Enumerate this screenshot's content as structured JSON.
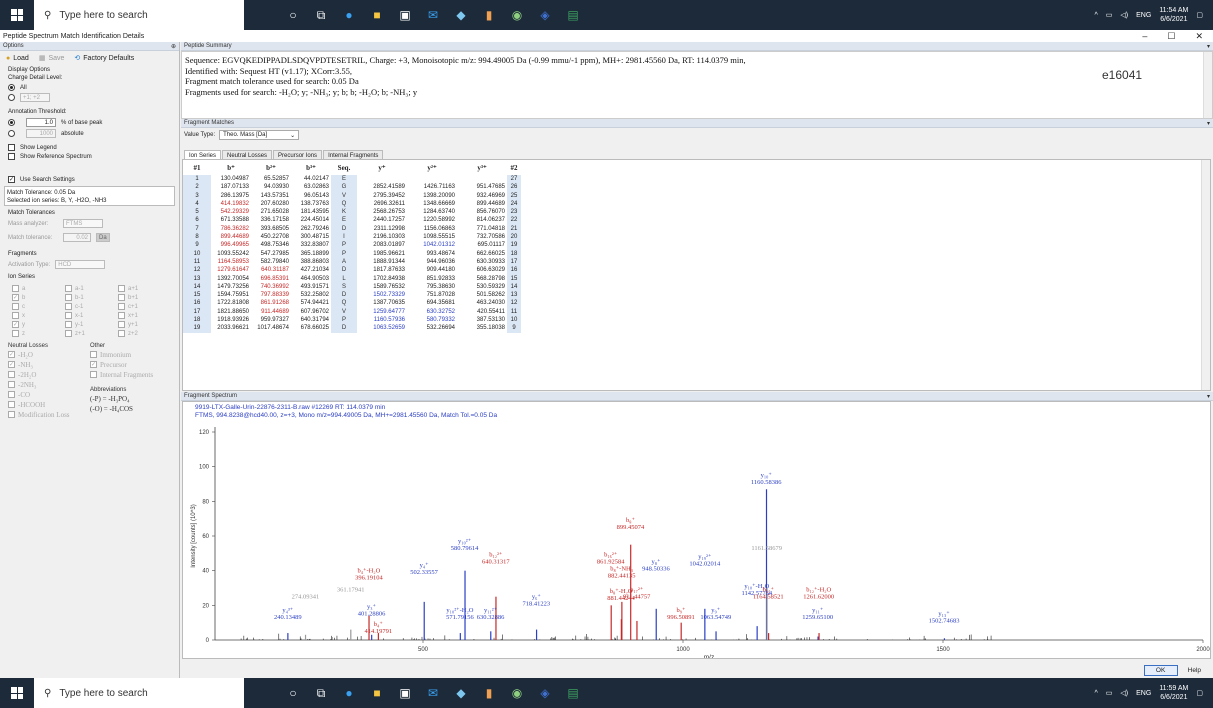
{
  "taskbar_top": {
    "search_placeholder": "Type here to search",
    "time": "11:54 AM",
    "date": "6/6/2021",
    "lang": "ENG"
  },
  "taskbar_bottom": {
    "search_placeholder": "Type here to search",
    "time": "11:59 AM",
    "date": "6/6/2021",
    "lang": "ENG"
  },
  "window": {
    "title": "Peptide Spectrum Match Identification Details",
    "min": "–",
    "max": "☐",
    "close": "✕"
  },
  "options": {
    "header": "Options",
    "load": "Load",
    "save": "Save",
    "factory": "Factory Defaults",
    "display_options": "Display Options",
    "charge_level": "Charge Detail Level:",
    "all": "All",
    "charge_value": "+1; +2",
    "annotation_threshold": "Annotation Threshold:",
    "pct_value": "1.0",
    "pct_label": "% of base peak",
    "abs_value": "1000",
    "abs_label": "absolute",
    "show_legend": "Show Legend",
    "show_reference": "Show Reference Spectrum",
    "use_search": "Use Search Settings",
    "info_line1": "Match Tolerance: 0.05 Da",
    "info_line2": "Selected ion series: B, Y, -H2O, -NH3",
    "match_tol": "Match Tolerances",
    "mass_analyzer": "Mass analyzer:",
    "mass_analyzer_val": "FTMS",
    "match_tolerance": "Match tolerance:",
    "tol_val": "0.02",
    "tol_unit": "Da",
    "fragments": "Fragments",
    "activation": "Activation Type:",
    "activation_val": "HCD",
    "ion_series": "Ion Series",
    "ions": [
      [
        "a",
        "a-1",
        "a+1"
      ],
      [
        "b",
        "b-1",
        "b+1"
      ],
      [
        "c",
        "c-1",
        "c+1"
      ],
      [
        "x",
        "x-1",
        "x+1"
      ],
      [
        "y",
        "y-1",
        "y+1"
      ],
      [
        "z",
        "z+1",
        "z+2"
      ]
    ],
    "neutral_losses": "Neutral Losses",
    "other": "Other",
    "nl": [
      "-H₂O",
      "-NH₃",
      "-2H₂O",
      "-2NH₃",
      "-CO",
      "-HCOOH",
      "Modification Loss"
    ],
    "other_items": [
      "Immonium",
      "Precursor",
      "Internal Fragments"
    ],
    "abbrev": "Abbreviations",
    "abbr1": "(-P) = -H₃PO₄",
    "abbr2": "(-O) = -H₄COS"
  },
  "summary": {
    "header": "Peptide Summary",
    "line1": "Sequence: EGVQKEDIPPADLSDQVPDTESETRIL, Charge: +3,   Monoisotopic m/z: 994.49005 Da (-0.99 mmu/-1 ppm),   MH+: 2981.45560 Da,   RT: 114.0379 min,",
    "line2": "Identified with: Sequest HT (v1.17); XCorr:3.55,",
    "line3": "Fragment match tolerance used for search: 0.05 Da",
    "line4": "Fragments used for search: -H₂O; y; -NH₃; y; b; b; -H₂O; b; -NH₃; y",
    "id": "e16041"
  },
  "fragment_matches": {
    "header": "Fragment Matches",
    "value_type_label": "Value Type:",
    "value_type": "Theo. Mass [Da]",
    "tabs": [
      "Ion Series",
      "Neutral Losses",
      "Precursor Ions",
      "Internal Fragments"
    ],
    "columns": [
      "#1",
      "b⁺",
      "b²⁺",
      "b³⁺",
      "Seq.",
      "y⁺",
      "y²⁺",
      "y³⁺",
      "#2"
    ],
    "rows": [
      [
        "1",
        "130.04987",
        "65.52857",
        "44.02147",
        "E",
        "",
        "",
        "",
        "27"
      ],
      [
        "2",
        "187.07133",
        "94.03930",
        "63.02863",
        "G",
        "2852.41589",
        "1426.71163",
        "951.47685",
        "26"
      ],
      [
        "3",
        "286.13975",
        "143.57351",
        "96.05143",
        "V",
        "2795.39452",
        "1398.20090",
        "932.46969",
        "25"
      ],
      [
        "4",
        "414.19832",
        "207.60280",
        "138.73763",
        "Q",
        "2696.32611",
        "1348.66669",
        "899.44689",
        "24"
      ],
      [
        "5",
        "542.29329",
        "271.65028",
        "181.43595",
        "K",
        "2568.26753",
        "1284.63740",
        "856.76070",
        "23"
      ],
      [
        "6",
        "671.33588",
        "336.17158",
        "224.45014",
        "E",
        "2440.17257",
        "1220.58992",
        "814.06237",
        "22"
      ],
      [
        "7",
        "786.36282",
        "393.68505",
        "262.79246",
        "D",
        "2311.12998",
        "1156.06863",
        "771.04818",
        "21"
      ],
      [
        "8",
        "899.44689",
        "450.22708",
        "300.48715",
        "I",
        "2196.10303",
        "1098.55515",
        "732.70586",
        "20"
      ],
      [
        "9",
        "996.49965",
        "498.75346",
        "332.83807",
        "P",
        "2083.01897",
        "1042.01312",
        "695.01117",
        "19"
      ],
      [
        "10",
        "1093.55242",
        "547.27985",
        "365.18899",
        "P",
        "1985.96621",
        "993.48674",
        "662.66025",
        "18"
      ],
      [
        "11",
        "1164.58953",
        "582.79840",
        "388.86803",
        "A",
        "1888.91344",
        "944.96036",
        "630.30933",
        "17"
      ],
      [
        "12",
        "1279.61647",
        "640.31187",
        "427.21034",
        "D",
        "1817.87633",
        "909.44180",
        "606.63029",
        "16"
      ],
      [
        "13",
        "1392.70054",
        "696.85391",
        "464.90503",
        "L",
        "1702.84938",
        "851.92833",
        "568.28798",
        "15"
      ],
      [
        "14",
        "1479.73256",
        "740.36992",
        "493.91571",
        "S",
        "1589.76532",
        "795.38630",
        "530.59329",
        "14"
      ],
      [
        "15",
        "1594.75951",
        "797.88339",
        "532.25802",
        "D",
        "1502.73329",
        "751.87028",
        "501.58262",
        "13"
      ],
      [
        "16",
        "1722.81808",
        "861.91268",
        "574.94421",
        "Q",
        "1387.70635",
        "694.35681",
        "463.24030",
        "12"
      ],
      [
        "17",
        "1821.88650",
        "911.44689",
        "607.96702",
        "V",
        "1259.64777",
        "630.32752",
        "420.55411",
        "11"
      ],
      [
        "18",
        "1918.93926",
        "959.97327",
        "640.31794",
        "P",
        "1160.57936",
        "580.79332",
        "387.53130",
        "10"
      ],
      [
        "19",
        "2033.96621",
        "1017.48674",
        "678.66025",
        "D",
        "1063.52659",
        "532.26694",
        "355.18038",
        "9"
      ]
    ],
    "red_cells": [
      "4-1",
      "5-1",
      "7-1",
      "8-1",
      "9-1",
      "11-1",
      "12-1",
      "12-2",
      "13-2",
      "14-2",
      "15-2",
      "16-2",
      "17-2"
    ],
    "blue_cells": [
      "9-6",
      "15-5",
      "17-5",
      "17-6",
      "18-5",
      "18-6",
      "19-5"
    ]
  },
  "spectrum": {
    "header": "Fragment Spectrum",
    "title1": "9919-LTX-Galle-Urin-22876-2311-B.raw #12269 RT: 114.0379 min",
    "title2": "FTMS, 994.8238@hcd40.00, z=+3, Mono m/z=994.49005 Da, MH+=2981.45560 Da, Match Tol.=0.05 Da",
    "ylabel": "Intensity [counts] (10^3)",
    "xlabel": "m/z",
    "yticks": [
      "0",
      "20",
      "40",
      "60",
      "80",
      "100",
      "120"
    ],
    "xticks": [
      "500",
      "1000",
      "1500",
      "2000"
    ],
    "peaks": [
      {
        "mz": 240.13489,
        "h": 4,
        "c": "#2b3fc4"
      },
      {
        "mz": 274.09,
        "h": 3,
        "c": "#999"
      },
      {
        "mz": 361.18,
        "h": 6,
        "c": "#999"
      },
      {
        "mz": 396.19104,
        "h": 14,
        "c": "#c62828"
      },
      {
        "mz": 401.28806,
        "h": 3,
        "c": "#2b3fc4"
      },
      {
        "mz": 414.19791,
        "h": 4,
        "c": "#c62828"
      },
      {
        "mz": 502.33557,
        "h": 22,
        "c": "#2b3fc4"
      },
      {
        "mz": 571.79156,
        "h": 4,
        "c": "#2b3fc4"
      },
      {
        "mz": 580.79614,
        "h": 40,
        "c": "#2b3fc4"
      },
      {
        "mz": 630.32886,
        "h": 5,
        "c": "#2b3fc4"
      },
      {
        "mz": 640.31317,
        "h": 25,
        "c": "#c62828"
      },
      {
        "mz": 718.41223,
        "h": 6,
        "c": "#2b3fc4"
      },
      {
        "mz": 861.92584,
        "h": 20,
        "c": "#c62828"
      },
      {
        "mz": 881.44244,
        "h": 12,
        "c": "#c62828"
      },
      {
        "mz": 882.44135,
        "h": 22,
        "c": "#c62828"
      },
      {
        "mz": 899.45074,
        "h": 55,
        "c": "#c62828"
      },
      {
        "mz": 911.44757,
        "h": 11,
        "c": "#c62828"
      },
      {
        "mz": 948.50336,
        "h": 18,
        "c": "#2b3fc4"
      },
      {
        "mz": 996.50891,
        "h": 10,
        "c": "#c62828"
      },
      {
        "mz": 1042.02014,
        "h": 18,
        "c": "#2b3fc4"
      },
      {
        "mz": 1063.54749,
        "h": 5,
        "c": "#2b3fc4"
      },
      {
        "mz": 1142.57764,
        "h": 8,
        "c": "#2b3fc4"
      },
      {
        "mz": 1160.58386,
        "h": 87,
        "c": "#2b3fc4"
      },
      {
        "mz": 1161.58679,
        "h": 30,
        "c": "#999"
      },
      {
        "mz": 1164.58521,
        "h": 4,
        "c": "#c62828"
      },
      {
        "mz": 1259.651,
        "h": 2,
        "c": "#2b3fc4"
      },
      {
        "mz": 1261.62,
        "h": 4,
        "c": "#c62828"
      },
      {
        "mz": 1502.74683,
        "h": 1,
        "c": "#2b3fc4"
      }
    ],
    "labels": [
      {
        "t": "240.13489",
        "sup": "y₄³⁺",
        "mz": 240,
        "y": 12,
        "c": "#2b3fc4"
      },
      {
        "t": "274.09341",
        "mz": 274,
        "y": 24,
        "c": "#999"
      },
      {
        "t": "361.17941",
        "mz": 361,
        "y": 28,
        "c": "#999"
      },
      {
        "t": "396.19104",
        "sup": "b₄⁺-H₂O",
        "mz": 396,
        "y": 35,
        "c": "#c62828"
      },
      {
        "t": "401.28806",
        "sup": "y₃⁺",
        "mz": 401,
        "y": 14,
        "c": "#2b3fc4"
      },
      {
        "t": "414.19791",
        "sup": "b₄⁺",
        "mz": 414,
        "y": 4,
        "c": "#c62828"
      },
      {
        "t": "502.33557",
        "sup": "y₄⁺",
        "mz": 502,
        "y": 38,
        "c": "#2b3fc4"
      },
      {
        "t": "571.79156",
        "sup": "y₁₀²⁺-H₂O",
        "mz": 571,
        "y": 12,
        "c": "#2b3fc4"
      },
      {
        "t": "580.79614",
        "sup": "y₁₀²⁺",
        "mz": 580,
        "y": 52,
        "c": "#2b3fc4"
      },
      {
        "t": "630.32886",
        "sup": "y₁₁²⁺",
        "mz": 630,
        "y": 12,
        "c": "#2b3fc4"
      },
      {
        "t": "640.31317",
        "sup": "b₁₂²⁺",
        "mz": 640,
        "y": 44,
        "c": "#c62828"
      },
      {
        "t": "718.41223",
        "sup": "y₆⁺",
        "mz": 718,
        "y": 20,
        "c": "#2b3fc4"
      },
      {
        "t": "861.92584",
        "sup": "b₁₆²⁺",
        "mz": 861,
        "y": 44,
        "c": "#c62828"
      },
      {
        "t": "882.44135",
        "sup": "b₈⁺-NH₃",
        "mz": 882,
        "y": 36,
        "c": "#c62828"
      },
      {
        "t": "881.44244",
        "sup": "b₈⁺-H₂O",
        "mz": 881,
        "y": 23,
        "c": "#c62828"
      },
      {
        "t": "899.45074",
        "sup": "b₈⁺",
        "mz": 899,
        "y": 64,
        "c": "#c62828"
      },
      {
        "t": "911.44757",
        "sup": "b₁₇²⁺",
        "mz": 911,
        "y": 24,
        "c": "#c62828"
      },
      {
        "t": "948.50336",
        "sup": "y₈⁺",
        "mz": 948,
        "y": 40,
        "c": "#2b3fc4"
      },
      {
        "t": "996.50891",
        "sup": "b₉⁺",
        "mz": 996,
        "y": 12,
        "c": "#c62828"
      },
      {
        "t": "1042.02014",
        "sup": "y₁₉²⁺",
        "mz": 1042,
        "y": 43,
        "c": "#2b3fc4"
      },
      {
        "t": "1063.54749",
        "sup": "y₉⁺",
        "mz": 1063,
        "y": 12,
        "c": "#2b3fc4"
      },
      {
        "t": "1142.57764",
        "sup": "y₁₀⁺-H₂O",
        "mz": 1142,
        "y": 26,
        "c": "#2b3fc4"
      },
      {
        "t": "1160.58386",
        "sup": "y₁₀⁺",
        "mz": 1160,
        "y": 90,
        "c": "#2b3fc4"
      },
      {
        "t": "1161.58679",
        "mz": 1161,
        "y": 52,
        "c": "#999"
      },
      {
        "t": "1164.58521",
        "sup": "b₁₁⁺",
        "mz": 1164,
        "y": 24,
        "c": "#c62828"
      },
      {
        "t": "1259.65100",
        "sup": "y₁₁⁺",
        "mz": 1259,
        "y": 12,
        "c": "#2b3fc4"
      },
      {
        "t": "1261.62000",
        "sup": "b₁₂⁺-H₂O",
        "mz": 1261,
        "y": 24,
        "c": "#c62828"
      },
      {
        "t": "1502.74683",
        "sup": "y₁₃⁺",
        "mz": 1502,
        "y": 10,
        "c": "#2b3fc4"
      }
    ]
  },
  "buttons": {
    "ok": "OK",
    "help": "Help"
  }
}
